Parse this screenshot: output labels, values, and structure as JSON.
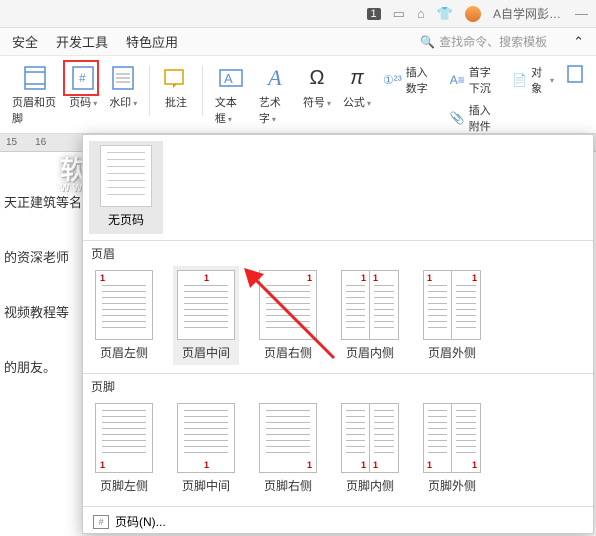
{
  "titlebar": {
    "badge": "1",
    "user": "A自学网彭老..."
  },
  "tabs": {
    "t1": "安全",
    "t2": "开发工具",
    "t3": "特色应用",
    "search": "查找命令、搜索模板"
  },
  "ribbon": {
    "header_footer": "页眉和页脚",
    "page_number": "页码",
    "watermark": "水印",
    "annotate": "批注",
    "textbox": "文本框",
    "wordart": "艺术字",
    "symbol": "符号",
    "formula": "公式",
    "insert_number": "插入数字",
    "dropcap": "首字下沉",
    "object": "对象",
    "attachment": "插入附件"
  },
  "ruler": {
    "m15": "15",
    "m16": "16"
  },
  "doc": {
    "l1": "天正建筑等名",
    "l2": "的资深老师",
    "l3": "视频教程等",
    "l4": "的朋友。"
  },
  "watermark": {
    "main": "软件自学网",
    "sub": "WWW.RJZXW.COM"
  },
  "dropdown": {
    "none": "无页码",
    "header_label": "页眉",
    "footer_label": "页脚",
    "header_items": [
      "页眉左侧",
      "页眉中间",
      "页眉右侧",
      "页眉内侧",
      "页眉外侧"
    ],
    "footer_items": [
      "页脚左侧",
      "页脚中间",
      "页脚右侧",
      "页脚内侧",
      "页脚外侧"
    ],
    "menu_pagenum": "页码(N)..."
  }
}
